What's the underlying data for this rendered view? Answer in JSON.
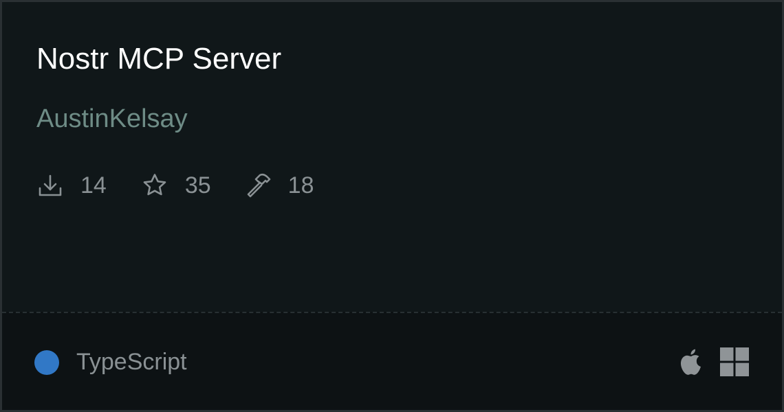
{
  "server": {
    "title": "Nostr MCP Server",
    "author": "AustinKelsay"
  },
  "stats": {
    "downloads": "14",
    "stars": "35",
    "tools": "18"
  },
  "language": {
    "name": "TypeScript",
    "color": "#3178c6"
  },
  "platforms": [
    "apple-icon",
    "windows-icon"
  ],
  "colors": {
    "background": "#101719",
    "footer_background": "#0d1214",
    "author": "#6e8c86",
    "muted": "#8a9194",
    "platform_icon": "#8f9497"
  }
}
